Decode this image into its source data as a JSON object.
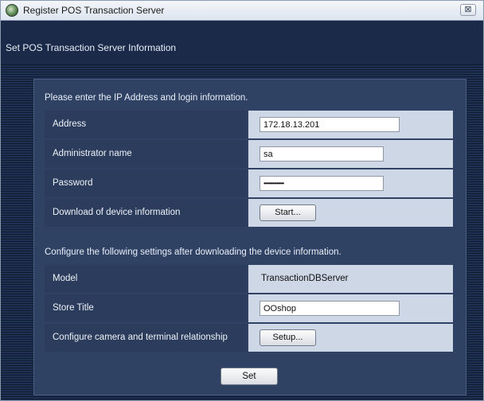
{
  "window": {
    "title": "Register POS Transaction Server",
    "close_glyph": "⊠"
  },
  "header": {
    "text": "Set POS Transaction Server Information"
  },
  "section1": {
    "label": "Please enter the IP Address and login information.",
    "rows": [
      {
        "label": "Address",
        "value": "172.18.13.201"
      },
      {
        "label": "Administrator name",
        "value": "sa"
      },
      {
        "label": "Password",
        "value": "••••••••••••••"
      },
      {
        "label": "Download of device information",
        "button": "Start..."
      }
    ]
  },
  "section2": {
    "label": "Configure the following settings after downloading the device information.",
    "rows": [
      {
        "label": "Model",
        "value": "TransactionDBServer"
      },
      {
        "label": "Store Title",
        "value": "OOshop"
      },
      {
        "label": "Configure camera and terminal relationship",
        "button": "Setup..."
      }
    ]
  },
  "footer": {
    "set_label": "Set"
  },
  "icons": {
    "app": "camera-icon",
    "close": "close-icon"
  }
}
